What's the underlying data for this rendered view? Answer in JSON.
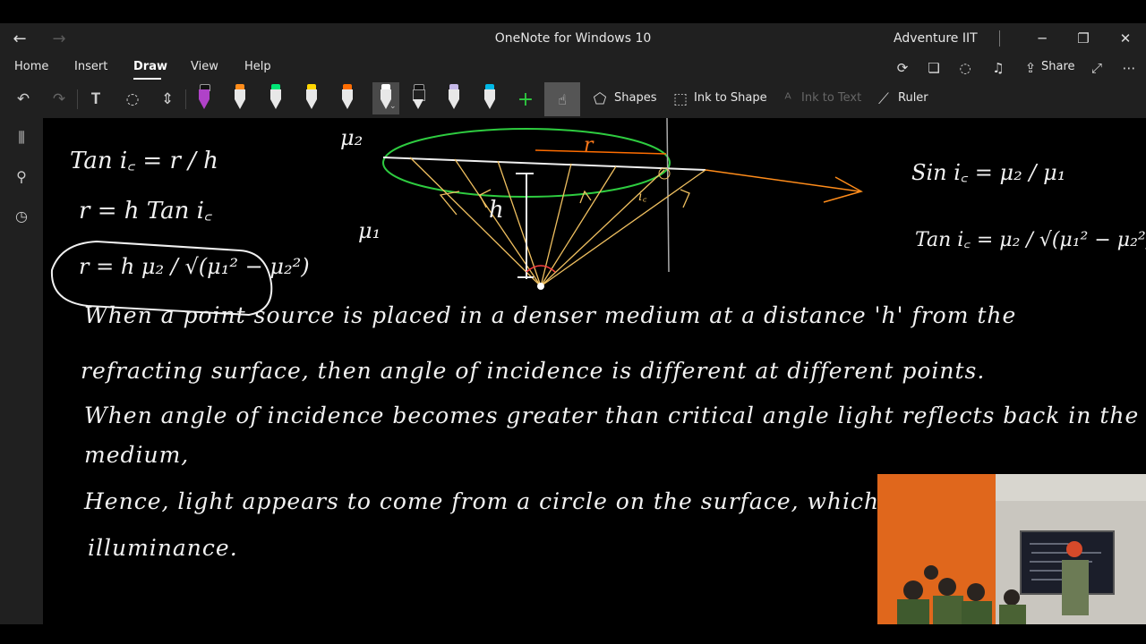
{
  "window": {
    "title": "OneNote for Windows 10",
    "user": "Adventure IIT"
  },
  "menu": {
    "items": [
      "Home",
      "Insert",
      "Draw",
      "View",
      "Help"
    ],
    "share_label": "Share"
  },
  "toolbar": {
    "shapes_label": "Shapes",
    "ink_to_shape_label": "Ink to Shape",
    "ink_to_text_label": "Ink to Text",
    "ruler_label": "Ruler",
    "pens": [
      {
        "name": "pen-purple",
        "color": "#b042c8"
      },
      {
        "name": "pen-orange",
        "color": "#ff8c1a"
      },
      {
        "name": "pen-green",
        "color": "#00e676"
      },
      {
        "name": "pen-yellow",
        "color": "#ffd600"
      },
      {
        "name": "pen-dark-orange",
        "color": "#ff6d00"
      },
      {
        "name": "pen-white",
        "color": "#ffffff"
      },
      {
        "name": "pen-black",
        "color": "#202020"
      },
      {
        "name": "pen-lavender",
        "color": "#c5b8e8"
      },
      {
        "name": "pen-cyan",
        "color": "#00b8e6"
      }
    ]
  },
  "notes": {
    "eq_left_1": "Tan i꜀ = r / h",
    "eq_left_2": "r = h Tan i꜀",
    "eq_boxed": "r = h μ₂ / √(μ₁² − μ₂²)",
    "mu2_label": "μ₂",
    "mu1_label": "μ₁",
    "h_label": "h",
    "r_label": "r",
    "ic_label": "i꜀",
    "eq_right_1": "Sin i꜀ = μ₂ / μ₁",
    "eq_right_2": "Tan i꜀ = μ₂ / √(μ₁² − μ₂²)",
    "line1": "When a point source is placed in a denser medium at a distance 'h' from the",
    "line2": "refracting surface, then angle of incidence is different at different points.",
    "line3": "When angle of incidence becomes greater than critical angle light reflects back in the",
    "line4": "medium,",
    "line5": "Hence, light appears to come from a circle on the surface, which",
    "line6": "illuminance."
  }
}
